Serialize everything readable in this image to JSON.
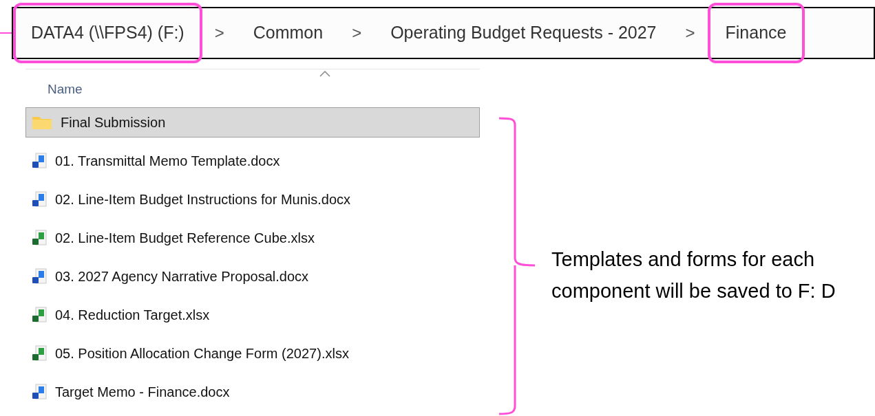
{
  "breadcrumb": [
    {
      "label": "DATA4 (\\\\FPS4) (F:)",
      "highlighted": true
    },
    {
      "label": "Common",
      "highlighted": false
    },
    {
      "label": "Operating Budget Requests - 2027",
      "highlighted": false
    },
    {
      "label": "Finance",
      "highlighted": true
    }
  ],
  "separator": ">",
  "file_list": {
    "column": "Name",
    "files": [
      {
        "name": "Final Submission",
        "kind": "folder",
        "selected": true
      },
      {
        "name": "01. Transmittal Memo Template.docx",
        "kind": "word",
        "selected": false
      },
      {
        "name": "02. Line-Item Budget Instructions for Munis.docx",
        "kind": "word",
        "selected": false
      },
      {
        "name": "02. Line-Item Budget Reference Cube.xlsx",
        "kind": "excel",
        "selected": false
      },
      {
        "name": "03. 2027 Agency Narrative Proposal.docx",
        "kind": "word",
        "selected": false
      },
      {
        "name": "04. Reduction Target.xlsx",
        "kind": "excel",
        "selected": false
      },
      {
        "name": "05. Position Allocation Change Form (2027).xlsx",
        "kind": "excel",
        "selected": false
      },
      {
        "name": "Target Memo - Finance.docx",
        "kind": "word",
        "selected": false
      }
    ]
  },
  "annotation": {
    "lines": [
      "Templates and forms for each",
      "component will be saved to F: D"
    ]
  }
}
